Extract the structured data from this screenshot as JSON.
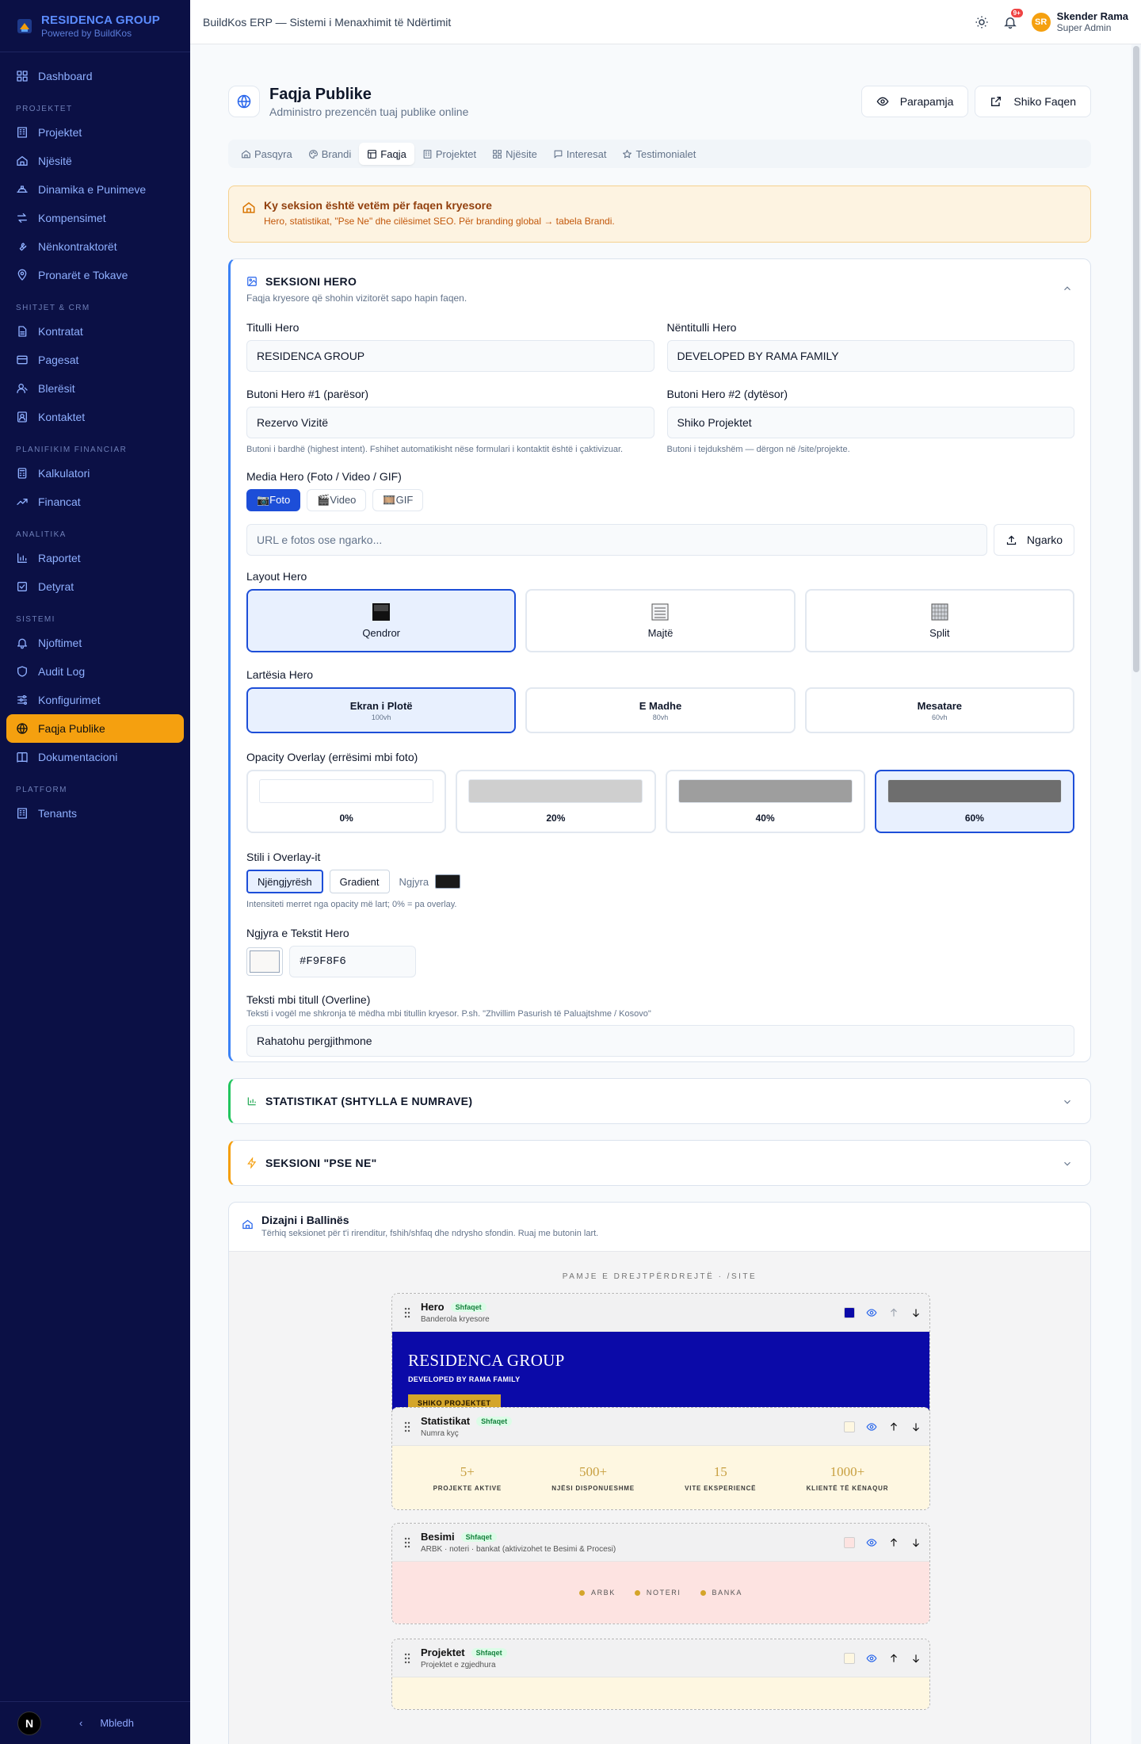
{
  "brand": {
    "name": "RESIDENCA GROUP",
    "sub": "Powered by BuildKos"
  },
  "sidebar": {
    "top": {
      "label": "Dashboard",
      "icon": "grid-icon"
    },
    "sections": [
      {
        "title": "PROJEKTET",
        "items": [
          {
            "label": "Projektet",
            "icon": "building-icon"
          },
          {
            "label": "Njësitë",
            "icon": "home-icon"
          },
          {
            "label": "Dinamika e Punimeve",
            "icon": "hardhat-icon"
          },
          {
            "label": "Kompensimet",
            "icon": "swap-icon"
          },
          {
            "label": "Nënkontraktorët",
            "icon": "wrench-icon"
          },
          {
            "label": "Pronarët e Tokave",
            "icon": "map-pin-icon"
          }
        ]
      },
      {
        "title": "SHITJET & CRM",
        "items": [
          {
            "label": "Kontratat",
            "icon": "file-icon"
          },
          {
            "label": "Pagesat",
            "icon": "card-icon"
          },
          {
            "label": "Blerësit",
            "icon": "user-icon"
          },
          {
            "label": "Kontaktet",
            "icon": "contact-icon"
          }
        ]
      },
      {
        "title": "PLANIFIKIM FINANCIAR",
        "items": [
          {
            "label": "Kalkulatori",
            "icon": "calculator-icon"
          },
          {
            "label": "Financat",
            "icon": "trend-icon"
          }
        ]
      },
      {
        "title": "ANALITIKA",
        "items": [
          {
            "label": "Raportet",
            "icon": "bar-chart-icon"
          },
          {
            "label": "Detyrat",
            "icon": "checkbox-icon"
          }
        ]
      },
      {
        "title": "SISTEMI",
        "items": [
          {
            "label": "Njoftimet",
            "icon": "bell-icon"
          },
          {
            "label": "Audit Log",
            "icon": "shield-icon"
          },
          {
            "label": "Konfigurimet",
            "icon": "sliders-icon"
          },
          {
            "label": "Faqja Publike",
            "icon": "globe-icon",
            "active": true
          },
          {
            "label": "Dokumentacioni",
            "icon": "book-icon"
          }
        ]
      },
      {
        "title": "PLATFORM",
        "items": [
          {
            "label": "Tenants",
            "icon": "building-icon"
          }
        ]
      }
    ],
    "footer": {
      "avatar": "N",
      "collapse": "Mbledh"
    }
  },
  "topbar": {
    "title": "BuildKos ERP — Sistemi i Menaxhimit të Ndërtimit",
    "badge": "9+",
    "user_initials": "SR",
    "user_name": "Skender Rama",
    "user_role": "Super Admin"
  },
  "page": {
    "title": "Faqja Publike",
    "subtitle": "Administro prezencën tuaj publike online",
    "preview": "Parapamja",
    "view": "Shiko Faqen"
  },
  "tabs": [
    {
      "label": "Pasqyra",
      "icon": "home-icon"
    },
    {
      "label": "Brandi",
      "icon": "palette-icon"
    },
    {
      "label": "Faqja",
      "icon": "layout-icon",
      "active": true
    },
    {
      "label": "Projektet",
      "icon": "building-icon"
    },
    {
      "label": "Njësite",
      "icon": "grid-icon"
    },
    {
      "label": "Interesat",
      "icon": "chat-icon"
    },
    {
      "label": "Testimonialet",
      "icon": "star-icon"
    }
  ],
  "alert": {
    "title": "Ky seksion është vetëm për faqen kryesore",
    "desc": "Hero, statistikat, \"Pse Ne\" dhe cilësimet SEO. Për branding global → tabela Brandi."
  },
  "hero": {
    "title": "SEKSIONI HERO",
    "subtitle": "Faqja kryesore që shohin vizitorët sapo hapin faqen.",
    "f_title_label": "Titulli Hero",
    "f_title_value": "RESIDENCA GROUP",
    "f_sub_label": "Nëntitulli Hero",
    "f_sub_value": "DEVELOPED BY RAMA FAMILY",
    "b1_label": "Butoni Hero #1 (parësor)",
    "b1_value": "Rezervo Vizitë",
    "b1_help": "Butoni i bardhë (highest intent). Fshihet automatikisht nëse formulari i kontaktit është i çaktivizuar.",
    "b2_label": "Butoni Hero #2 (dytësor)",
    "b2_value": "Shiko Projektet",
    "b2_help": "Butoni i tejdukshëm — dërgon në /site/projekte.",
    "media_label": "Media Hero (Foto / Video / GIF)",
    "media": [
      {
        "label": "📷Foto",
        "active": true
      },
      {
        "label": "🎬Video"
      },
      {
        "label": "🎞️GIF"
      }
    ],
    "url_placeholder": "URL e fotos ose ngarko...",
    "upload": "Ngarko",
    "layout_label": "Layout Hero",
    "layouts": [
      {
        "label": "Qendror",
        "active": true
      },
      {
        "label": "Majtë"
      },
      {
        "label": "Split"
      }
    ],
    "height_label": "Lartësia Hero",
    "heights": [
      {
        "label": "Ekran i Plotë",
        "sub": "100vh",
        "active": true
      },
      {
        "label": "E Madhe",
        "sub": "80vh"
      },
      {
        "label": "Mesatare",
        "sub": "60vh"
      }
    ],
    "opacity_label": "Opacity Overlay (errësimi mbi foto)",
    "opacities": [
      {
        "label": "0%",
        "value": 0
      },
      {
        "label": "20%",
        "value": 0.2
      },
      {
        "label": "40%",
        "value": 0.4
      },
      {
        "label": "60%",
        "value": 0.6,
        "active": true
      }
    ],
    "style_label": "Stili i Overlay-it",
    "style_solid": "Njëngjyrësh",
    "style_gradient": "Gradient",
    "style_color_label": "Ngjyra",
    "overlay_color": "#1a1a1a",
    "style_help": "Intensiteti merret nga opacity më lart; 0% = pa overlay.",
    "text_color_label": "Ngjyra e Tekstit Hero",
    "text_color": "#F9F8F6",
    "overline_label": "Teksti mbi titull (Overline)",
    "overline_help": "Teksti i vogël me shkronja të mëdha mbi titullin kryesor. P.sh. \"Zhvillim Pasurish të Paluajtshme / Kosovo\"",
    "overline_value": "Rahatohu pergjithmone"
  },
  "stats_section": {
    "title": "STATISTIKAT (SHTYLLA E NUMRAVE)"
  },
  "why_section": {
    "title": "SEKSIONI \"PSE NE\""
  },
  "design": {
    "title": "Dizajni i Ballinës",
    "subtitle": "Tërhiq seksionet për t'i rirenditur, fshih/shfaq dhe ndrysho sfondin. Ruaj me butonin lart.",
    "canvas_label": "PAMJE E DREJTPËRDREJTË · /SITE",
    "tag": "Shfaqet",
    "blocks": [
      {
        "name": "Hero",
        "sub": "Banderola kryesore",
        "swatch": "#0b0aa8"
      },
      {
        "name": "Statistikat",
        "sub": "Numra kyç",
        "swatch": "#fef7e1"
      },
      {
        "name": "Besimi",
        "sub": "ARBK · noteri · bankat (aktivizohet te Besimi & Procesi)",
        "swatch": "#fde3e1"
      },
      {
        "name": "Projektet",
        "sub": "Projektet e zgjedhura",
        "swatch": "#fef7e1"
      }
    ],
    "hero_preview": {
      "title": "RESIDENCA GROUP",
      "sub": "DEVELOPED BY RAMA FAMILY",
      "btn": "SHIKO PROJEKTET"
    },
    "stats_preview": [
      {
        "v": "5+",
        "l": "PROJEKTE AKTIVE"
      },
      {
        "v": "500+",
        "l": "NJËSI DISPONUESHME"
      },
      {
        "v": "15",
        "l": "VITE EKSPERIENCË"
      },
      {
        "v": "1000+",
        "l": "KLIENTË TË KËNAQUR"
      }
    ],
    "trust_preview": [
      "ARBK",
      "NOTERI",
      "BANKA"
    ]
  }
}
